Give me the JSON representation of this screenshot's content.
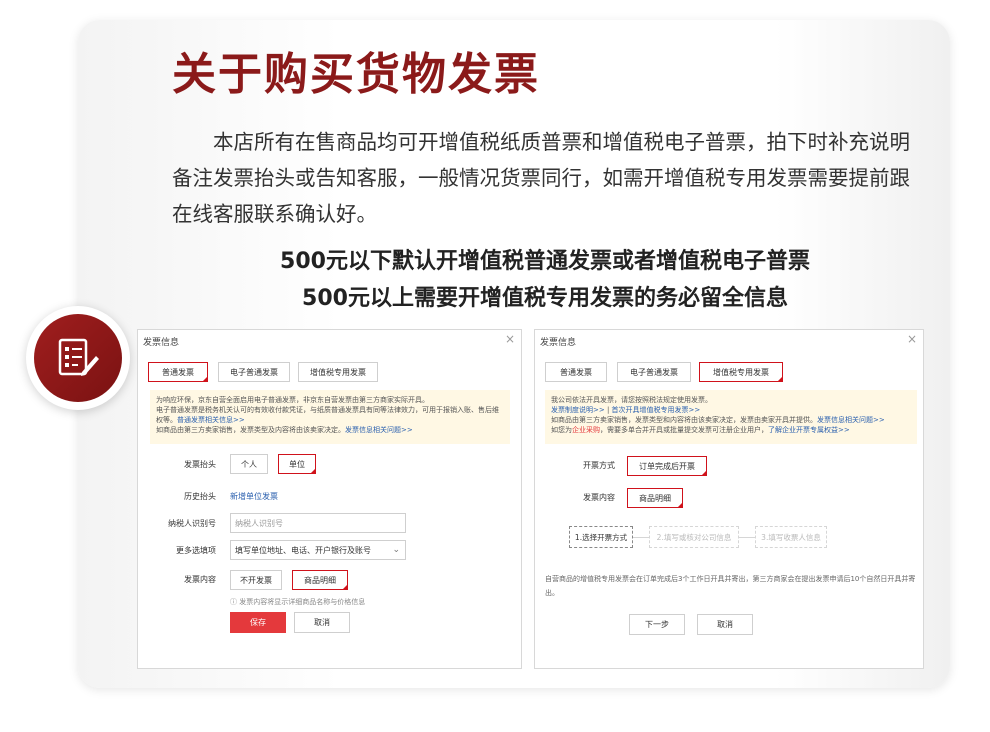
{
  "title": "关于购买货物发票",
  "intro": "本店所有在售商品均可开增值税纸质普票和增值税电子普票，拍下时补充说明备注发票抬头或告知客服，一般情况货票同行，如需开增值税专用发票需要提前跟在线客服联系确认好。",
  "headline_1": "500元以下默认开增值税普通发票或者增值税电子普票",
  "headline_2": "500元以上需要开增值税专用发票的务必留全信息",
  "left_dialog": {
    "title": "发票信息",
    "close": "×",
    "tabs": [
      "普通发票",
      "电子普通发票",
      "增值税专用发票"
    ],
    "selected_tab": "普通发票",
    "notice_1": "为响应环保，京东自营全面启用电子普通发票，非京东自营发票由第三方商家实际开具。",
    "notice_2": "电子普通发票是税务机关认可的有效收付款凭证，与纸质普通发票具有同等法律效力，可用于报销入账、售后维权等。",
    "notice_link_1": "普通发票相关信息>>",
    "notice_3": "如商品由第三方卖家销售，发票类型及内容将由该卖家决定。",
    "notice_link_2": "发票信息相关问题>>",
    "header_label": "发票抬头",
    "header_options": [
      "个人",
      "单位"
    ],
    "history_label": "历史抬头",
    "history_link": "新增单位发票",
    "taxid_label": "纳税人识别号",
    "taxid_placeholder": "纳税人识别号",
    "more_label": "更多选填项",
    "more_value": "填写单位地址、电话、开户银行及账号",
    "content_label": "发票内容",
    "content_options": [
      "不开发票",
      "商品明细"
    ],
    "content_hint": "ⓘ 发票内容将显示详细商品名称与价格信息",
    "save_btn": "保存",
    "cancel_btn": "取消"
  },
  "right_dialog": {
    "title": "发票信息",
    "close": "×",
    "tabs": [
      "普通发票",
      "电子普通发票",
      "增值税专用发票"
    ],
    "selected_tab": "增值税专用发票",
    "notice_1": "我公司依法开具发票，请您按照税法规定使用发票。",
    "notice_link_1": "发票制度说明>>",
    "notice_link_2": "首次开具增值税专用发票>>",
    "notice_2": "如商品由第三方卖家销售，发票类型和内容将由该卖家决定，发票由卖家开具并提供。",
    "notice_link_3": "发票信息相关问题>>",
    "notice_3a": "如您为",
    "notice_link_4": "企业采购",
    "notice_3b": "，需要多单合并开具或批量提交发票可注册企业用户，",
    "notice_link_5": "了解企业开票专属权益>>",
    "method_label": "开票方式",
    "method_value": "订单完成后开票",
    "content_label": "发票内容",
    "content_value": "商品明细",
    "steps": [
      "1.选择开票方式",
      "2.填写或核对公司信息",
      "3.填写收票人信息"
    ],
    "footer_text": "自营商品的增值税专用发票会在订单完成后3个工作日开具并寄出，第三方商家会在提出发票申请后10个自然日开具并寄出。",
    "next_btn": "下一步",
    "cancel_btn": "取消"
  },
  "colors": {
    "title": "#8b1a1a",
    "accent": "#d0121b",
    "link": "#2a5fae"
  },
  "icons": {
    "badge": "checklist-pen-icon"
  }
}
